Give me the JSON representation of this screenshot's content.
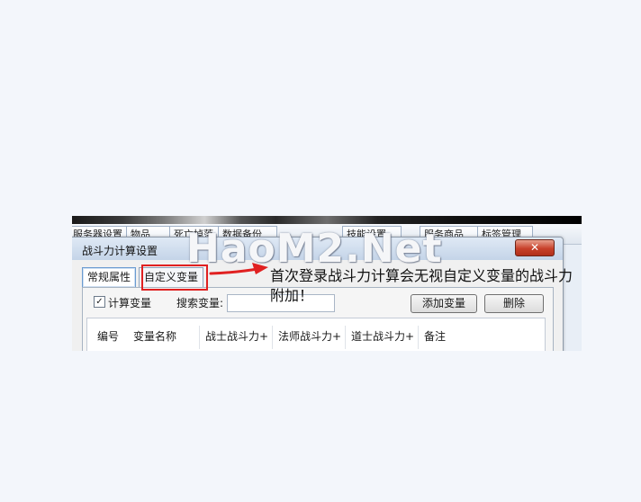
{
  "background_tabs": [
    "服务器设置",
    "物品",
    "死亡掉落",
    "数据备份",
    "",
    "",
    "技能设置",
    "服务商品",
    "标签管理"
  ],
  "dialog": {
    "title": "战斗力计算设置",
    "close_label": "✕",
    "tabs": [
      {
        "label": "常规属性",
        "active": true
      },
      {
        "label": "自定义变量",
        "active": false
      }
    ],
    "toolbar": {
      "calc_checkbox_label": "计算变量",
      "calc_checked": true,
      "search_label": "搜索变量:",
      "search_value": "",
      "add_button": "添加变量",
      "delete_button": "删除"
    },
    "table": {
      "columns": [
        "编号",
        "变量名称",
        "战士战斗力+",
        "法师战斗力+",
        "道士战斗力+",
        "备注"
      ]
    }
  },
  "overlay": {
    "watermark": "HaoM2.Net",
    "annotation": "首次登录战斗力计算会无视自定义变量的战斗力附加！",
    "highlight_color": "#e02020"
  }
}
